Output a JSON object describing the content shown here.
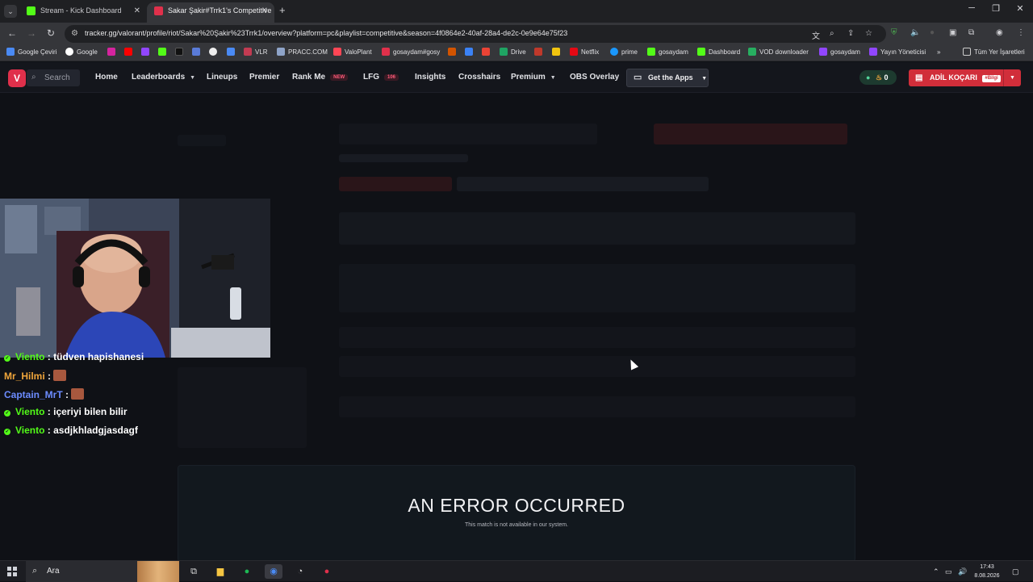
{
  "browser": {
    "tabs": [
      {
        "title": "Stream - Kick Dashboard",
        "icon": "kick-icon",
        "color": "#53fc18"
      },
      {
        "title": "Sakar Şakir#Trrk1's Competitive",
        "icon": "tracker-icon",
        "color": "#e0304b"
      }
    ],
    "url": "tracker.gg/valorant/profile/riot/Sakar%20Şakir%23Trrk1/overview?platform=pc&playlist=competitive&season=4f0864e2-40af-28a4-de2c-0e9e64e75f23",
    "bookmarks": [
      "Google Çeviri",
      "Google",
      "VLR",
      "PRACC.COM",
      "ValoPlant",
      "gosaydam#gosy",
      "Drive",
      "Netflix",
      "prime",
      "gosaydam",
      "Dashboard",
      "VOD downloader",
      "gosaydam",
      "Yayın Yöneticisi",
      "Tüm Yer İşaretleri"
    ]
  },
  "site": {
    "search_placeholder": "Search",
    "nav": {
      "home": "Home",
      "leaderboards": "Leaderboards",
      "lineups": "Lineups",
      "premier": "Premier",
      "rankme": "Rank Me",
      "rankme_badge": "NEW",
      "lfg": "LFG",
      "lfg_badge": "106",
      "insights": "Insights",
      "crosshairs": "Crosshairs",
      "premium": "Premium",
      "obs": "OBS Overlay",
      "getapps": "Get the Apps"
    },
    "coins": "0",
    "user": "ADİL KOÇARI",
    "user_tag": "#Bilgi",
    "accent": "#d12e3a"
  },
  "chat": [
    {
      "name": "Viento",
      "text": ": tüdven hapishanesi",
      "badge": true,
      "color": "green"
    },
    {
      "name": "Mr_Hilmi",
      "text": ":",
      "emote": true,
      "color": "orange"
    },
    {
      "name": "Captain_MrT",
      "text": ":",
      "emote": true,
      "color": "blue"
    },
    {
      "name": "Viento",
      "text": ": içeriyi bilen bilir",
      "badge": true,
      "color": "green"
    },
    {
      "name": "Viento",
      "text": ": asdjkhladgjasdagf",
      "badge": true,
      "color": "green"
    }
  ],
  "error": {
    "title": "AN ERROR OCCURRED",
    "subtitle": "This match is not available in our system."
  },
  "taskbar": {
    "search": "Ara",
    "time": "17:43",
    "date": "8.08.2026"
  }
}
